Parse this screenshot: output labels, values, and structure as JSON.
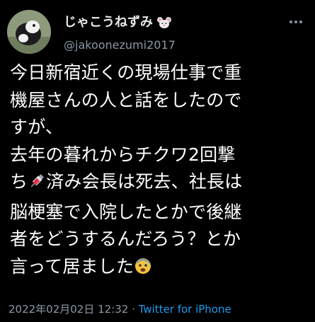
{
  "tweet": {
    "display_name": "じゃこうねずみ",
    "name_emoji": "mouse-face-icon",
    "handle": "@jakoonezumi2017",
    "text_lines": [
      "今日新宿近くの現場仕事で重",
      "機屋さんの人と話をしたので",
      "すが、",
      "去年の暮れからチクワ2回撃",
      "ち",
      "済み会長は死去、社長は",
      "脳梗塞で入院したとかで後継",
      "者をどうするんだろう？とか",
      "言って居ました"
    ],
    "timestamp": "2022年02月02日 12:32",
    "separator": " · ",
    "source": "Twitter for iPhone"
  },
  "colors": {
    "background": "#000000",
    "text": "#ffffff",
    "secondary": "#8b98a5",
    "link": "#1d9bf0"
  },
  "icons": [
    "avatar",
    "mouse-face-icon",
    "more-icon",
    "syringe-icon",
    "anxious-face-icon"
  ]
}
